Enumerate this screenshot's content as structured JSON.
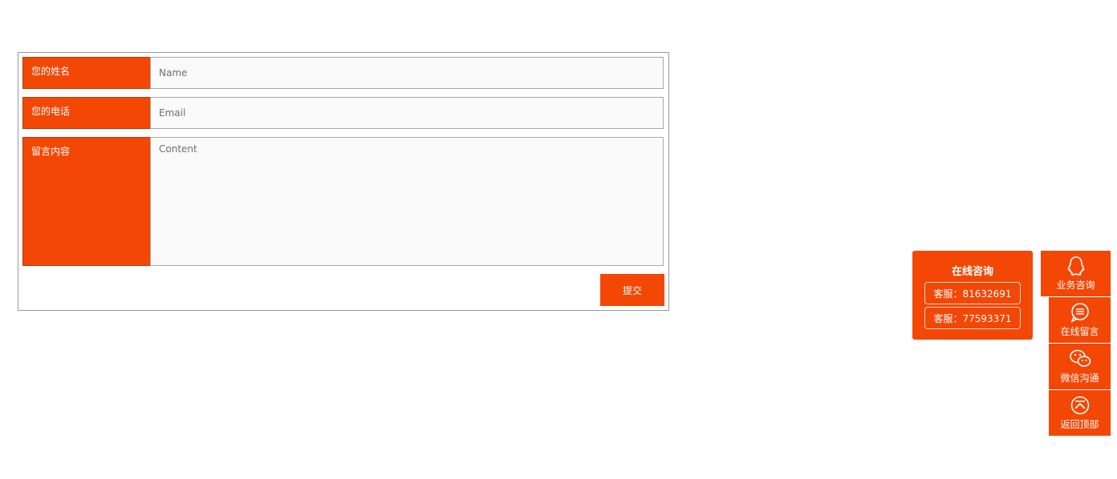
{
  "form": {
    "name_label": "您的姓名",
    "name_placeholder": "Name",
    "phone_label": "您的电话",
    "phone_placeholder": "Email",
    "content_label": "留言内容",
    "content_placeholder": "Content",
    "submit_label": "提交"
  },
  "consult": {
    "title": "在线咨询",
    "services": [
      "客服：81632691",
      "客服：77593371"
    ]
  },
  "sidebar": {
    "items": [
      {
        "label": "业务咨询",
        "icon": "qq-icon"
      },
      {
        "label": "在线留言",
        "icon": "message-icon"
      },
      {
        "label": "微信沟通",
        "icon": "wechat-icon"
      },
      {
        "label": "返回顶部",
        "icon": "back-to-top-icon"
      }
    ]
  },
  "colors": {
    "accent": "#f34705",
    "field_bg": "#fafafa",
    "border": "#a9a9a9"
  }
}
